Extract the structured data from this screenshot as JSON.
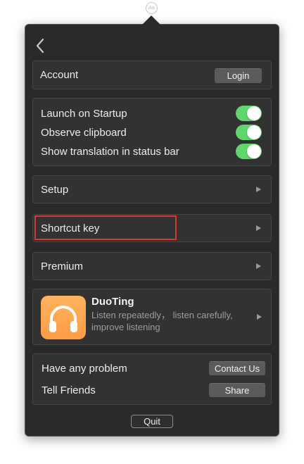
{
  "status_icon": {
    "text": "Aa"
  },
  "header": {
    "back_icon": "chevron-left-icon"
  },
  "account": {
    "label": "Account",
    "login_label": "Login"
  },
  "toggles": [
    {
      "label": "Launch on Startup",
      "on": true
    },
    {
      "label": "Observe clipboard",
      "on": true
    },
    {
      "label": "Show translation in status bar",
      "on": true
    }
  ],
  "menu": {
    "setup": "Setup",
    "shortcut_key": "Shortcut key",
    "premium": "Premium"
  },
  "promo": {
    "app_name": "DuoTing",
    "description_line1": "Listen repeatedly， listen carefully,",
    "description_line2": "improve listening",
    "icon": "headphones-icon"
  },
  "support": {
    "problem_label": "Have any problem",
    "contact_label": "Contact Us",
    "friends_label": "Tell Friends",
    "share_label": "Share"
  },
  "footer": {
    "quit_label": "Quit"
  },
  "colors": {
    "background": "#2a2a2a",
    "card": "#323232",
    "toggle_on": "#5fd76c",
    "highlight": "#d8382b",
    "app_icon": "#ffa24f"
  }
}
